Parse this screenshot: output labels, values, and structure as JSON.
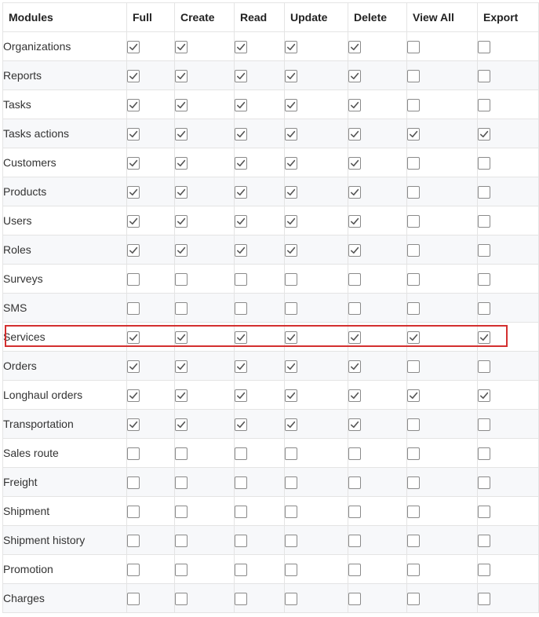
{
  "table": {
    "headers": [
      "Modules",
      "Full",
      "Create",
      "Read",
      "Update",
      "Delete",
      "View All",
      "Export"
    ],
    "rows": [
      {
        "module": "Organizations",
        "perms": [
          true,
          true,
          true,
          true,
          true,
          false,
          false
        ]
      },
      {
        "module": "Reports",
        "perms": [
          true,
          true,
          true,
          true,
          true,
          false,
          false
        ]
      },
      {
        "module": "Tasks",
        "perms": [
          true,
          true,
          true,
          true,
          true,
          false,
          false
        ]
      },
      {
        "module": "Tasks actions",
        "perms": [
          true,
          true,
          true,
          true,
          true,
          true,
          true
        ]
      },
      {
        "module": "Customers",
        "perms": [
          true,
          true,
          true,
          true,
          true,
          false,
          false
        ]
      },
      {
        "module": "Products",
        "perms": [
          true,
          true,
          true,
          true,
          true,
          false,
          false
        ]
      },
      {
        "module": "Users",
        "perms": [
          true,
          true,
          true,
          true,
          true,
          false,
          false
        ]
      },
      {
        "module": "Roles",
        "perms": [
          true,
          true,
          true,
          true,
          true,
          false,
          false
        ]
      },
      {
        "module": "Surveys",
        "perms": [
          false,
          false,
          false,
          false,
          false,
          false,
          false
        ]
      },
      {
        "module": "SMS",
        "perms": [
          false,
          false,
          false,
          false,
          false,
          false,
          false
        ]
      },
      {
        "module": "Services",
        "perms": [
          true,
          true,
          true,
          true,
          true,
          true,
          true
        ],
        "highlighted": true
      },
      {
        "module": "Orders",
        "perms": [
          true,
          true,
          true,
          true,
          true,
          false,
          false
        ]
      },
      {
        "module": "Longhaul orders",
        "perms": [
          true,
          true,
          true,
          true,
          true,
          true,
          true
        ]
      },
      {
        "module": "Transportation",
        "perms": [
          true,
          true,
          true,
          true,
          true,
          false,
          false
        ]
      },
      {
        "module": "Sales route",
        "perms": [
          false,
          false,
          false,
          false,
          false,
          false,
          false
        ]
      },
      {
        "module": "Freight",
        "perms": [
          false,
          false,
          false,
          false,
          false,
          false,
          false
        ]
      },
      {
        "module": "Shipment",
        "perms": [
          false,
          false,
          false,
          false,
          false,
          false,
          false
        ]
      },
      {
        "module": "Shipment history",
        "perms": [
          false,
          false,
          false,
          false,
          false,
          false,
          false
        ]
      },
      {
        "module": "Promotion",
        "perms": [
          false,
          false,
          false,
          false,
          false,
          false,
          false
        ]
      },
      {
        "module": "Charges",
        "perms": [
          false,
          false,
          false,
          false,
          false,
          false,
          false
        ]
      }
    ]
  },
  "colors": {
    "highlight_border": "#d32f2f",
    "checkbox_border": "#8a8a8a",
    "checkmark": "#555555",
    "row_stripe": "#f7f8fa"
  },
  "icons": {
    "checked": "checkmark-icon"
  }
}
